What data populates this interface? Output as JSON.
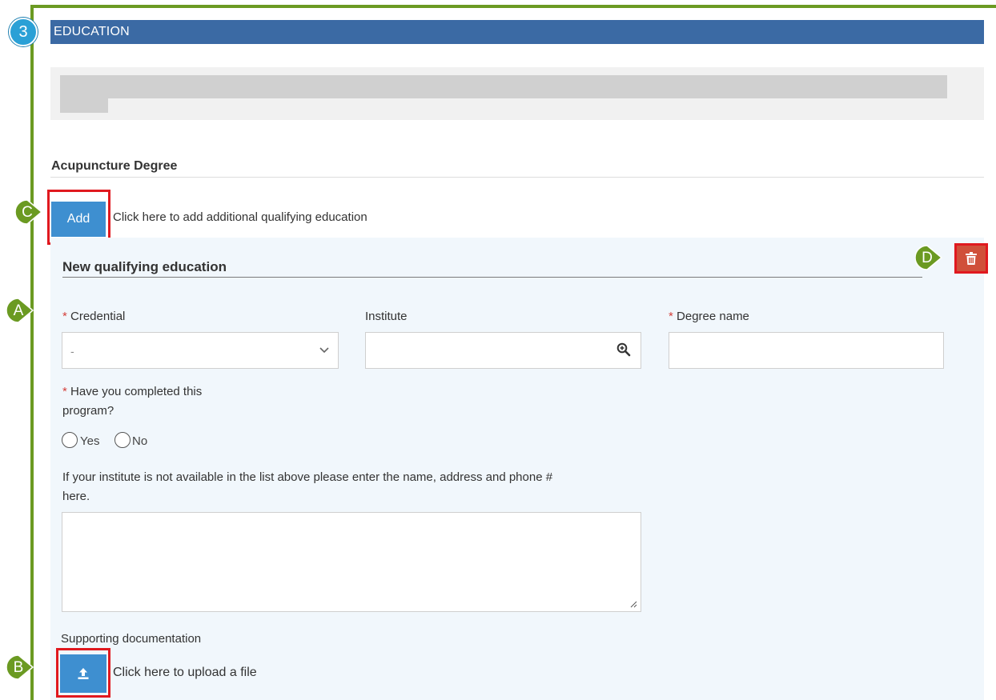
{
  "step": {
    "number": "3"
  },
  "section": {
    "title": "EDUCATION"
  },
  "subsection": {
    "title": "Acupuncture Degree"
  },
  "add": {
    "label": "Add",
    "hint": "Click here to add additional qualifying education"
  },
  "card": {
    "title": "New qualifying education",
    "fields": {
      "credential": {
        "required_mark": "*",
        "label": "Credential",
        "value": "-"
      },
      "institute": {
        "label": "Institute",
        "value": ""
      },
      "degree": {
        "required_mark": "*",
        "label": "Degree name",
        "value": ""
      },
      "completed": {
        "required_mark": "*",
        "label_line1": "Have you completed this",
        "label_line2": "program?",
        "options": [
          "Yes",
          "No"
        ]
      },
      "other_institute": {
        "label_line1": "If your institute is not available in the list above please enter the name, address and phone #",
        "label_line2": "here.",
        "value": ""
      },
      "documentation": {
        "label": "Supporting documentation",
        "upload_hint": "Click here to upload a file"
      }
    }
  },
  "callouts": [
    "A",
    "B",
    "C",
    "D"
  ],
  "icons": {
    "chevron": "chevron-down-icon",
    "zoom": "zoom-in-icon",
    "trash": "trash-icon",
    "upload": "upload-icon"
  },
  "colors": {
    "header_bg": "#3b6aa4",
    "frame_green": "#6b9a22",
    "button_blue": "#3e8fd0",
    "delete_red": "#d0503a",
    "highlight_red": "#e0191f",
    "callout_green": "#6b9a22",
    "step_blue": "#2aa0d6"
  }
}
